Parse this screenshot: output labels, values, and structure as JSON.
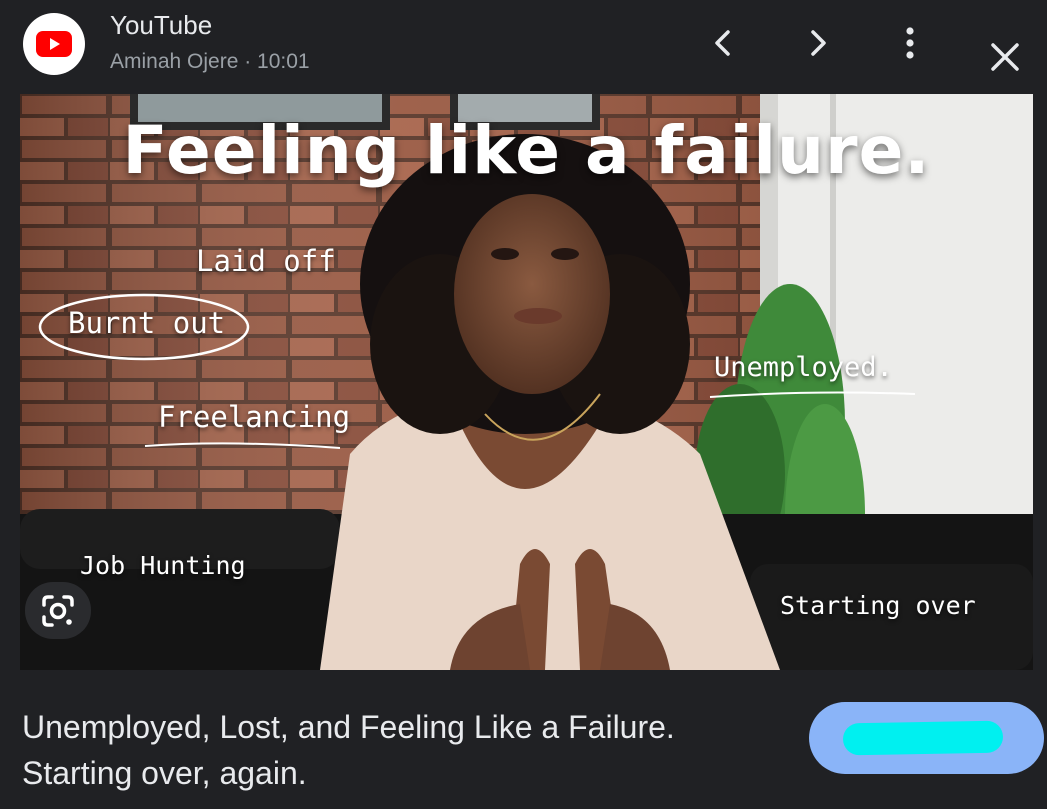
{
  "header": {
    "source_name": "YouTube",
    "source_meta": "Aminah Ojere · 10:01",
    "logo_icon": "youtube-logo-icon",
    "buttons": {
      "prev": "chevron-left-icon",
      "next": "chevron-right-icon",
      "more": "more-vert-icon",
      "close": "close-icon"
    }
  },
  "thumbnail": {
    "title": "Feeling like a failure.",
    "annotations": {
      "laid_off": "Laid off",
      "burnt_out": "Burnt out",
      "freelancing": "Freelancing",
      "unemployed": "Unemployed.",
      "job_hunting": "Job Hunting",
      "starting_over": "Starting over"
    }
  },
  "lens_button": {
    "icon": "google-lens-icon"
  },
  "caption": {
    "line1": "Unemployed, Lost, and Feeling Like a Failure.",
    "line2": "Starting over, again."
  },
  "colors": {
    "background": "#202124",
    "youtube_red": "#ff0000",
    "visit_button": "#8ab4f8",
    "redaction": "#00f0f0"
  }
}
